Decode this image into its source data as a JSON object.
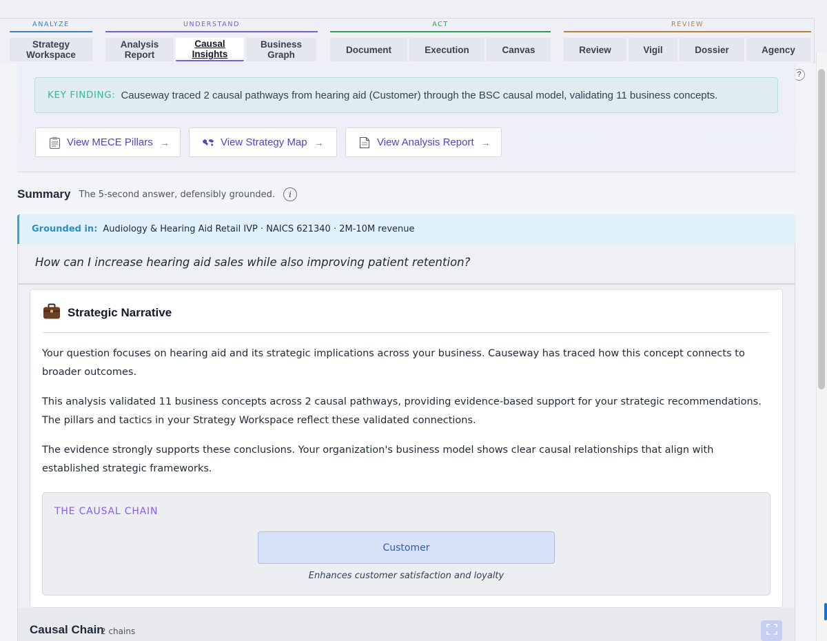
{
  "nav": {
    "groups": [
      {
        "label": "ANALYZE",
        "color": "#3b82c4"
      },
      {
        "label": "UNDERSTAND",
        "color": "#7c5cdb"
      },
      {
        "label": "ACT",
        "color": "#2f9e5b"
      },
      {
        "label": "REVIEW",
        "color": "#b7823a"
      }
    ],
    "tabs": {
      "strategy_workspace": "Strategy Workspace",
      "analysis_report": "Analysis Report",
      "causal_insights": "Causal Insights",
      "business_graph": "Business Graph",
      "document": "Document",
      "execution": "Execution",
      "canvas": "Canvas",
      "review": "Review",
      "vigil": "Vigil",
      "dossier": "Dossier",
      "agency": "Agency"
    },
    "active_tab": "Causal Insights"
  },
  "help": {
    "label": "?"
  },
  "key_finding": {
    "label": "KEY FINDING:",
    "text": "Causeway traced 2 causal pathways from hearing aid (Customer) through the BSC causal model, validating 11 business concepts."
  },
  "actions": {
    "mece": {
      "label": "View MECE Pillars",
      "icon": "clipboard-icon",
      "arrow": "→"
    },
    "strategy_map": {
      "label": "View Strategy Map",
      "icon": "world-map-icon",
      "arrow": "→"
    },
    "analysis_report": {
      "label": "View Analysis Report",
      "icon": "document-icon",
      "arrow": "→"
    }
  },
  "summary": {
    "title": "Summary",
    "subtitle": "The 5-second answer, defensibly grounded.",
    "info_icon": "i"
  },
  "grounded": {
    "label": "Grounded in:",
    "text": "Audiology & Hearing Aid Retail IVP · NAICS 621340 · 2M-10M revenue"
  },
  "question": "How can I increase hearing aid sales while also improving patient retention?",
  "narrative": {
    "icon": "briefcase-icon",
    "title": "Strategic Narrative",
    "paragraphs": [
      "Your question focuses on hearing aid and its strategic implications across your business. Causeway has traced how this concept connects to broader outcomes.",
      "This analysis validated 11 business concepts across 2 causal pathways, providing evidence-based support for your strategic recommendations. The pillars and tactics in your Strategy Workspace reflect these validated connections.",
      "The evidence strongly supports these conclusions. Your organization's business model shows clear causal relationships that align with established strategic frameworks."
    ]
  },
  "causal_chain_box": {
    "label": "THE CAUSAL CHAIN",
    "node": "Customer",
    "description": "Enhances customer satisfaction and loyalty"
  },
  "causal_chain_section": {
    "title": "Causal Chain",
    "count": "2 chains"
  },
  "colors": {
    "accent": "#7c5cdb",
    "link": "#4f46c4",
    "key_finding_label": "#3bb3a2",
    "grounded_label": "#2b8fc2"
  }
}
